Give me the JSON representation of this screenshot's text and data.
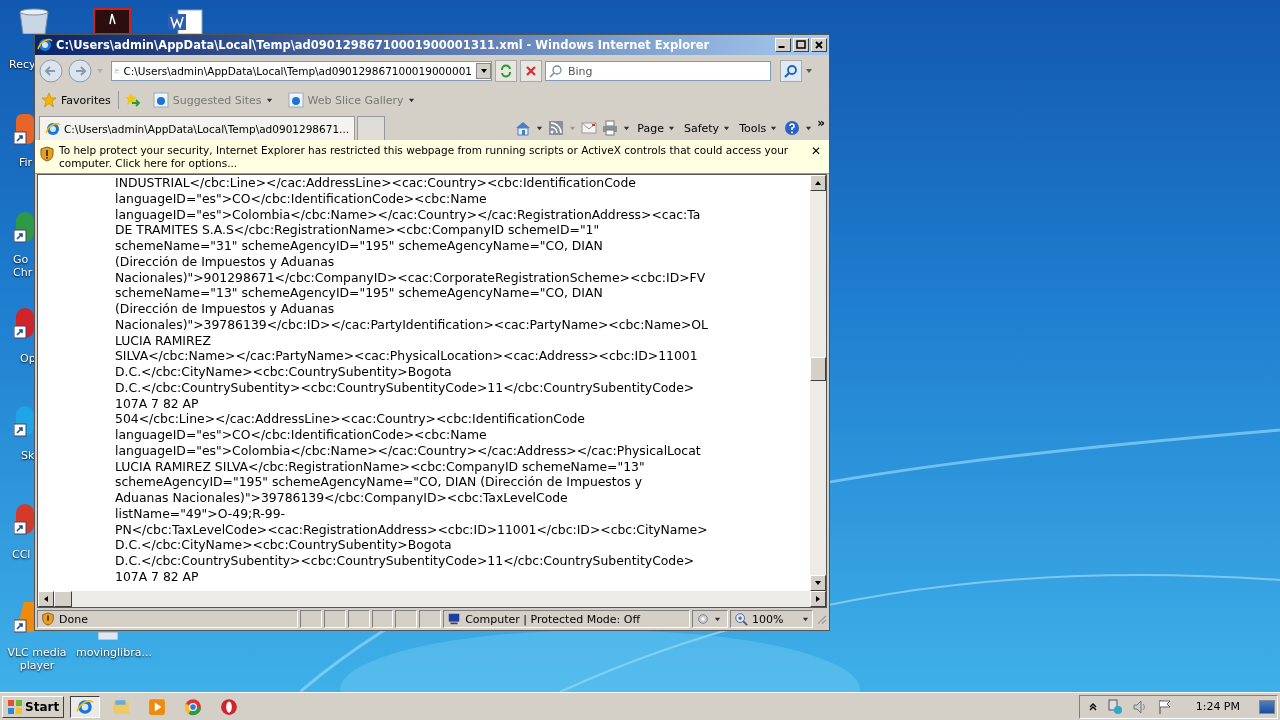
{
  "desktop_icons": [
    {
      "kind": "bin",
      "label": "Recy"
    },
    {
      "kind": "pdf"
    },
    {
      "kind": "doc"
    },
    {
      "kind": "fox",
      "label": "Fir"
    },
    {
      "kind": "chrome",
      "label": "Go Chr"
    },
    {
      "kind": "opera",
      "label": "Op"
    },
    {
      "kind": "skype",
      "label": "Sk"
    },
    {
      "kind": "ccleaner",
      "label": "CCl"
    },
    {
      "kind": "vlc",
      "label": "VLC media player"
    },
    {
      "kind": "file",
      "label": "movinglibra..."
    }
  ],
  "window": {
    "title": "C:\\Users\\admin\\AppData\\Local\\Temp\\ad09012986710001900001311.xml - Windows Internet Explorer"
  },
  "address_bar": {
    "value": "C:\\Users\\admin\\AppData\\Local\\Temp\\ad090129867100019000001"
  },
  "search": {
    "placeholder": "Bing"
  },
  "favorites_bar": {
    "label": "Favorites",
    "links": [
      "Suggested Sites",
      "Web Slice Gallery"
    ]
  },
  "tabs": [
    {
      "label": "C:\\Users\\admin\\AppData\\Local\\Temp\\ad0901298671...",
      "selected": true
    }
  ],
  "command_bar": {
    "menus": [
      "Page",
      "Safety",
      "Tools"
    ],
    "more": "»"
  },
  "info_bar": {
    "text": "To help protect your security, Internet Explorer has restricted this webpage from running scripts or ActiveX controls that could access your computer. Click here for options...",
    "close": "✕"
  },
  "content_lines": [
    "INDUSTRIAL</cbc:Line></cac:AddressLine><cac:Country><cbc:IdentificationCode",
    "languageID=\"es\">CO</cbc:IdentificationCode><cbc:Name",
    "languageID=\"es\">Colombia</cbc:Name></cac:Country></cac:RegistrationAddress><cac:Ta",
    "DE TRAMITES S.A.S</cbc:RegistrationName><cbc:CompanyID schemeID=\"1\"",
    "schemeName=\"31\" schemeAgencyID=\"195\" schemeAgencyName=\"CO, DIAN",
    "(Dirección de Impuestos y Aduanas",
    "Nacionales)\">901298671</cbc:CompanyID><cac:CorporateRegistrationScheme><cbc:ID>FV",
    "schemeName=\"13\" schemeAgencyID=\"195\" schemeAgencyName=\"CO, DIAN",
    "(Dirección de Impuestos y Aduanas",
    "Nacionales)\">39786139</cbc:ID></cac:PartyIdentification><cac:PartyName><cbc:Name>OL",
    "LUCIA RAMIREZ",
    "SILVA</cbc:Name></cac:PartyName><cac:PhysicalLocation><cac:Address><cbc:ID>11001",
    "D.C.</cbc:CityName><cbc:CountrySubentity>Bogota",
    "D.C.</cbc:CountrySubentity><cbc:CountrySubentityCode>11</cbc:CountrySubentityCode>",
    "107A 7 82 AP",
    "504</cbc:Line></cac:AddressLine><cac:Country><cbc:IdentificationCode",
    "languageID=\"es\">CO</cbc:IdentificationCode><cbc:Name",
    "languageID=\"es\">Colombia</cbc:Name></cac:Country></cac:Address></cac:PhysicalLocat",
    "LUCIA RAMIREZ SILVA</cbc:RegistrationName><cbc:CompanyID schemeName=\"13\"",
    "schemeAgencyID=\"195\" schemeAgencyName=\"CO, DIAN (Dirección de Impuestos y",
    "Aduanas Nacionales)\">39786139</cbc:CompanyID><cbc:TaxLevelCode",
    "listName=\"49\">O-49;R-99-",
    "PN</cbc:TaxLevelCode><cac:RegistrationAddress><cbc:ID>11001</cbc:ID><cbc:CityName>",
    "D.C.</cbc:CityName><cbc:CountrySubentity>Bogota",
    "D.C.</cbc:CountrySubentity><cbc:CountrySubentityCode>11</cbc:CountrySubentityCode>",
    "107A 7 82 AP"
  ],
  "status_bar": {
    "status": "Done",
    "zone": "Computer | Protected Mode: Off",
    "zoom": "100%"
  },
  "taskbar": {
    "start": "Start",
    "apps": [
      {
        "kind": "ie",
        "selected": true
      },
      {
        "kind": "explorer",
        "selected": false
      },
      {
        "kind": "media",
        "selected": false
      },
      {
        "kind": "chrome",
        "selected": false
      },
      {
        "kind": "opera",
        "selected": false
      }
    ],
    "clock": "1:24 PM"
  }
}
